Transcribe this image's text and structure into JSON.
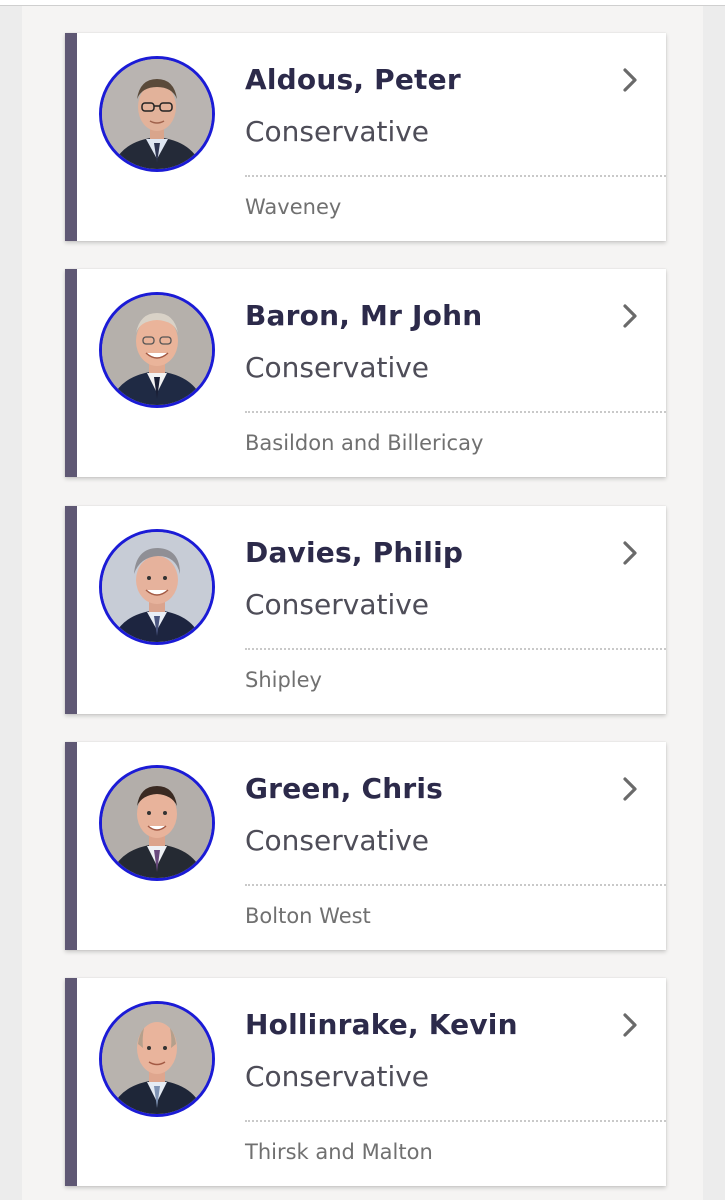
{
  "members": [
    {
      "name": "Aldous, Peter",
      "party": "Conservative",
      "constituency": "Waveney",
      "portrait_icon": "portrait-glasses-man"
    },
    {
      "name": "Baron, Mr John",
      "party": "Conservative",
      "constituency": "Basildon and Billericay",
      "portrait_icon": "portrait-smiling-man"
    },
    {
      "name": "Davies, Philip",
      "party": "Conservative",
      "constituency": "Shipley",
      "portrait_icon": "portrait-grey-hair-man"
    },
    {
      "name": "Green, Chris",
      "party": "Conservative",
      "constituency": "Bolton West",
      "portrait_icon": "portrait-dark-hair-man"
    },
    {
      "name": "Hollinrake, Kevin",
      "party": "Conservative",
      "constituency": "Thirsk and Malton",
      "portrait_icon": "portrait-bald-man"
    }
  ],
  "colors": {
    "party_stripe": "#5f5874",
    "portrait_ring": "#1b1bd6",
    "name_text": "#2c2a4a",
    "chevron": "#6a6a6a"
  },
  "icons": {
    "chevron": "chevron-right-icon"
  }
}
